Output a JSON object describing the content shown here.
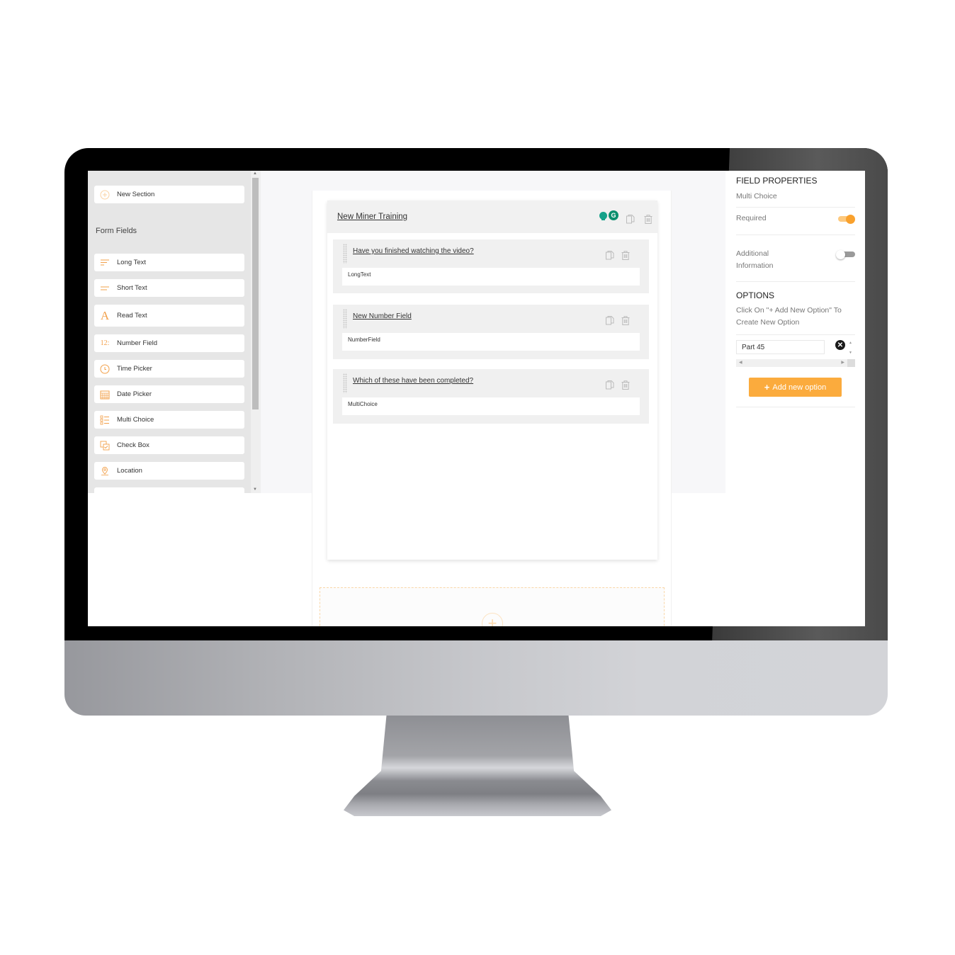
{
  "sidebar": {
    "new_section": {
      "label": "New Section",
      "icon": "plus-circle-icon"
    },
    "form_fields_title": "Form Fields",
    "items": [
      {
        "label": "Long Text",
        "icon": "long-text-icon"
      },
      {
        "label": "Short Text",
        "icon": "short-text-icon"
      },
      {
        "label": "Read Text",
        "icon": "read-text-icon",
        "glyph": "A"
      },
      {
        "label": "Number Field",
        "icon": "number-icon",
        "glyph": "12:"
      },
      {
        "label": "Time Picker",
        "icon": "clock-icon"
      },
      {
        "label": "Date Picker",
        "icon": "calendar-icon"
      },
      {
        "label": "Multi Choice",
        "icon": "list-icon"
      },
      {
        "label": "Check Box",
        "icon": "checkbox-icon"
      },
      {
        "label": "Location",
        "icon": "location-pin-icon"
      }
    ]
  },
  "canvas": {
    "section": {
      "title": "New Miner Training",
      "fields": [
        {
          "title": "Have you finished watching the video?",
          "type": "LongText"
        },
        {
          "title": "New Number Field",
          "type": "NumberField"
        },
        {
          "title": "Which of these have been completed?",
          "type": "MultiChoice"
        }
      ]
    },
    "grammarly_glyph": "G"
  },
  "properties": {
    "title": "FIELD PROPERTIES",
    "field_type": "Multi Choice",
    "required_label": "Required",
    "required_on": true,
    "additional_label": "Additional Information",
    "additional_on": false,
    "options_title": "OPTIONS",
    "options_hint": "Click On \"+ Add New Option\" To Create New Option",
    "options": [
      {
        "value": "Part 45"
      }
    ],
    "remove_glyph": "✕",
    "add_button_label": "Add new option",
    "add_button_glyph": "+"
  },
  "colors": {
    "accent": "#fbab3d",
    "icon_orange": "#f2a04a",
    "toggle_on": "#f9a12d",
    "grammarly": "#0b8f6e"
  }
}
